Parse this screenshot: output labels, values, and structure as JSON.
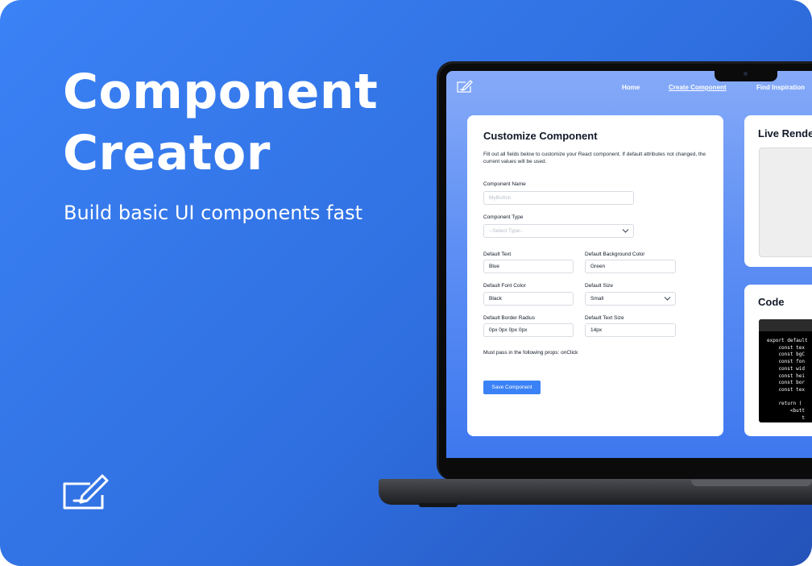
{
  "hero": {
    "title_line1": "Component",
    "title_line2": "Creator",
    "subtitle": "Build basic UI components fast",
    "icon": "edit-icon"
  },
  "nav": {
    "logo_icon": "edit-icon",
    "items": [
      {
        "label": "Home"
      },
      {
        "label": "Create Component",
        "active": true
      },
      {
        "label": "Find Inspiration"
      }
    ]
  },
  "form": {
    "title": "Customize Component",
    "description": "Fill out all fields below to customize your React component. If default attributes not changed, the current values will be used.",
    "component_name": {
      "label": "Component Name",
      "value": "",
      "placeholder": "MyButton"
    },
    "component_type": {
      "label": "Component Type",
      "value": "--Select Type--"
    },
    "default_text": {
      "label": "Default Text",
      "value": "Blue"
    },
    "default_bg_color": {
      "label": "Default Background Color",
      "value": "Green"
    },
    "default_font_color": {
      "label": "Default Font Color",
      "value": "Black"
    },
    "default_size": {
      "label": "Default Size",
      "value": "Small"
    },
    "default_border_radius": {
      "label": "Default Border Radius",
      "value": "0px 0px 0px 0px"
    },
    "default_text_size": {
      "label": "Default Text Size",
      "value": "14px"
    },
    "props_note": "Must pass in the following props: onClick",
    "save_label": "Save Component"
  },
  "live_render": {
    "title": "Live Rende"
  },
  "code": {
    "title": "Code",
    "lines": [
      "export default",
      "    const tex",
      "    const bgC",
      "    const fon",
      "    const wid",
      "    const hei",
      "    const bor",
      "    const tex",
      "",
      "    return (",
      "        <butt",
      "            t"
    ]
  },
  "colors": {
    "accent": "#3b82f6",
    "background_gradient_start": "#3b82f6",
    "background_gradient_end": "#2452b8"
  }
}
